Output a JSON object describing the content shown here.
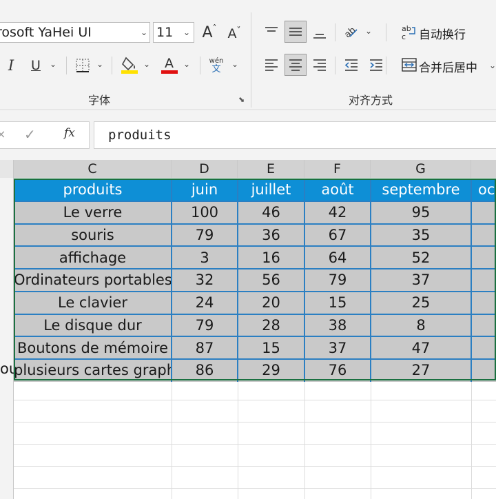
{
  "ribbon": {
    "font_name": "rosoft YaHei UI",
    "font_size": "11",
    "grow_font": "A",
    "shrink_font": "A",
    "italic": "I",
    "underline": "U",
    "font_group_label": "字体",
    "align_group_label": "对齐方式",
    "wrap_text_label": "自动换行",
    "merge_center_label": "合并后居中",
    "phonetic_top": "wén",
    "phonetic_bottom": "文",
    "colors": {
      "highlight": "#ffe100",
      "font": "#e01010"
    }
  },
  "formula_bar": {
    "fx": "fx",
    "value": "produits"
  },
  "columns": [
    "C",
    "D",
    "E",
    "F",
    "G"
  ],
  "table": {
    "headers": [
      "produits",
      "juin",
      "juillet",
      "août",
      "septembre",
      "oc"
    ],
    "rows": [
      {
        "product": "Le verre",
        "values": [
          "100",
          "46",
          "42",
          "95"
        ]
      },
      {
        "product": "souris",
        "values": [
          "79",
          "36",
          "67",
          "35"
        ]
      },
      {
        "product": "affichage",
        "values": [
          "3",
          "16",
          "64",
          "52"
        ]
      },
      {
        "product": "Ordinateurs portables",
        "values": [
          "32",
          "56",
          "79",
          "37"
        ]
      },
      {
        "product": "Le clavier",
        "values": [
          "24",
          "20",
          "15",
          "25"
        ]
      },
      {
        "product": "Le disque dur",
        "values": [
          "79",
          "28",
          "38",
          "8"
        ]
      },
      {
        "product": "Boutons de mémoire",
        "values": [
          "87",
          "15",
          "37",
          "47"
        ]
      },
      {
        "product": "plusieurs cartes graphiques",
        "values": [
          "86",
          "29",
          "76",
          "27"
        ]
      }
    ],
    "spill_text": "ou",
    "colors": {
      "header_bg": "#0e8fd6",
      "body_bg": "#c9c9c9",
      "cell_border": "#2b7fc2",
      "selection": "#1a7040"
    }
  }
}
